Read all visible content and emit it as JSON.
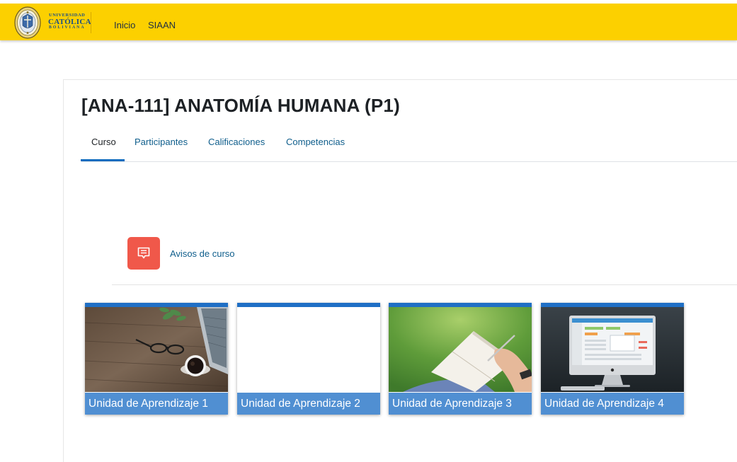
{
  "navbar": {
    "logo": {
      "line1": "UNIVERSIDAD",
      "line2": "CATÓLICA",
      "line3": "BOLIVIANA"
    },
    "links": [
      {
        "label": "Inicio"
      },
      {
        "label": "SIAAN"
      }
    ]
  },
  "course": {
    "title": "[ANA-111] ANATOMÍA HUMANA (P1)"
  },
  "tabs": [
    {
      "label": "Curso",
      "active": true
    },
    {
      "label": "Participantes",
      "active": false
    },
    {
      "label": "Calificaciones",
      "active": false
    },
    {
      "label": "Competencias",
      "active": false
    }
  ],
  "announcements": {
    "label": "Avisos de curso",
    "icon": "forum-chat-icon",
    "icon_color": "#f0584a"
  },
  "units": [
    {
      "label": "Unidad de Aprendizaje 1",
      "image": "desk-coffee-glasses-laptop"
    },
    {
      "label": "Unidad de Aprendizaje 2",
      "image": "blank"
    },
    {
      "label": "Unidad de Aprendizaje 3",
      "image": "person-writing-notebook-grass"
    },
    {
      "label": "Unidad de Aprendizaje 4",
      "image": "desktop-computer-dashboard"
    }
  ],
  "colors": {
    "navbar": "#fcd000",
    "link": "#0f5e8c",
    "tab_underline": "#0f6cbf",
    "tile_accent": "#1f6fc5"
  }
}
